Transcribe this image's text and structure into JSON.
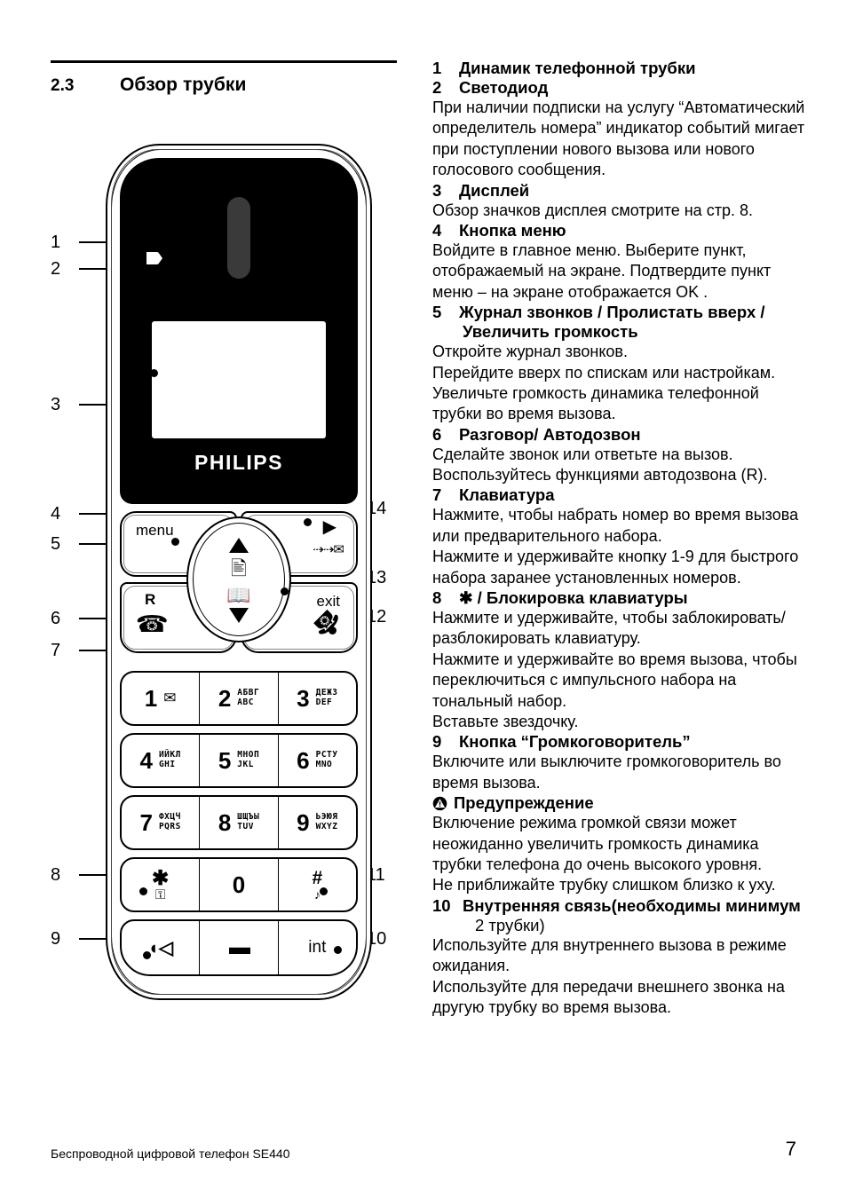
{
  "section": {
    "number": "2.3",
    "title": "Обзор трубки"
  },
  "phone": {
    "brand": "PHILIPS",
    "softkeys": {
      "menu": "menu",
      "exit": "exit",
      "recall": "R"
    },
    "keypad": [
      [
        {
          "num": "1",
          "letters": "",
          "icon": "✉"
        },
        {
          "num": "2",
          "letters": "АБВГ\nABC",
          "icon": ""
        },
        {
          "num": "3",
          "letters": "ДЕЖЗ\nDEF",
          "icon": ""
        }
      ],
      [
        {
          "num": "4",
          "letters": "ИЙКЛ\nGHI",
          "icon": ""
        },
        {
          "num": "5",
          "letters": "МНОП\nJKL",
          "icon": ""
        },
        {
          "num": "6",
          "letters": "РСТУ\nMNO",
          "icon": ""
        }
      ],
      [
        {
          "num": "7",
          "letters": "ФХЦЧ\nPQRS",
          "icon": ""
        },
        {
          "num": "8",
          "letters": "ШЩЪЫ\nTUV",
          "icon": ""
        },
        {
          "num": "9",
          "letters": "ЬЭЮЯ\nWXYZ",
          "icon": ""
        }
      ],
      [
        {
          "num": "✱",
          "letters": "",
          "icon": "⚿"
        },
        {
          "num": "0",
          "letters": "",
          "icon": ""
        },
        {
          "num": "#",
          "letters": "",
          "icon": "♪"
        }
      ],
      [
        {
          "num": "◖◁",
          "letters": "",
          "icon": ""
        },
        {
          "num": "▬",
          "letters": "",
          "icon": ""
        },
        {
          "num": "int",
          "letters": "",
          "icon": ""
        }
      ]
    ],
    "callouts_left": [
      "1",
      "2",
      "3",
      "4",
      "5",
      "6",
      "7",
      "8",
      "9"
    ],
    "callouts_right": [
      "14",
      "13",
      "12",
      "11",
      "10"
    ]
  },
  "legend": [
    {
      "n": "1",
      "title": "Динамик телефонной трубки",
      "body": []
    },
    {
      "n": "2",
      "title": "Светодиод",
      "body": [
        "При наличии подписки на услугу “Автоматический определитель номера” индикатор событий мигает при поступлении нового вызова или нового голосового сообщения."
      ]
    },
    {
      "n": "3",
      "title": "Дисплей",
      "body": [
        "Обзор значков дисплея смотрите на стр. 8."
      ]
    },
    {
      "n": "4",
      "title": "Кнопка меню",
      "body": [
        "Войдите в главное меню. Выберите пункт, отображаемый на экране. Подтвердите пункт меню – на экране отображается OK ."
      ]
    },
    {
      "n": "5",
      "title": "Журнал звонков / Пролистать вверх /",
      "title2": "Увеличить громкость",
      "body": [
        "Откройте журнал звонков.",
        "Перейдите вверх по спискам или настройкам.",
        "Увеличьте громкость динамика телефонной трубки во время вызова."
      ]
    },
    {
      "n": "6",
      "title": "Разговор/ Автодозвон",
      "body": [
        "Сделайте звонок или ответьте на вызов.",
        "Воспользуйтесь функциями автодозвона (R)."
      ]
    },
    {
      "n": "7",
      "title": "Клавиатура",
      "body": [
        "Нажмите, чтобы набрать номер во время вызова или предварительного набора.",
        "Нажмите и удерживайте кнопку 1-9 для быстрого набора заранее установленных номеров."
      ]
    },
    {
      "n": "8",
      "title": "✱ / Блокировка клавиатуры",
      "body": [
        "Нажмите и удерживайте, чтобы заблокировать/ разблокировать клавиатуру.",
        "Нажмите и удерживайте во время вызова, чтобы переключиться с импульсного набора на тональный набор.",
        "Вставьте звездочку."
      ]
    },
    {
      "n": "9",
      "title": "Кнопка “Громкоговоритель”",
      "body": [
        "Включите или выключите громкоговоритель во время вызова."
      ]
    }
  ],
  "warning": {
    "heading": "Предупреждение",
    "body": [
      "Включение режима громкой связи может неожиданно увеличить громкость динамика трубки телефона до очень высокого уровня.",
      "Не приближайте трубку слишком близко к уху."
    ]
  },
  "legend10": {
    "n": "10",
    "title": "Внутренняя связь",
    "title_tail": " (необходимы минимум",
    "title_second": "2 трубки)",
    "body": [
      "Используйте для внутреннего вызова в режиме ожидания.",
      "Используйте для передачи внешнего звонка на другую трубку во время вызова."
    ]
  },
  "footer": {
    "left": "Беспроводной цифровой телефон SE440",
    "page": "7"
  }
}
